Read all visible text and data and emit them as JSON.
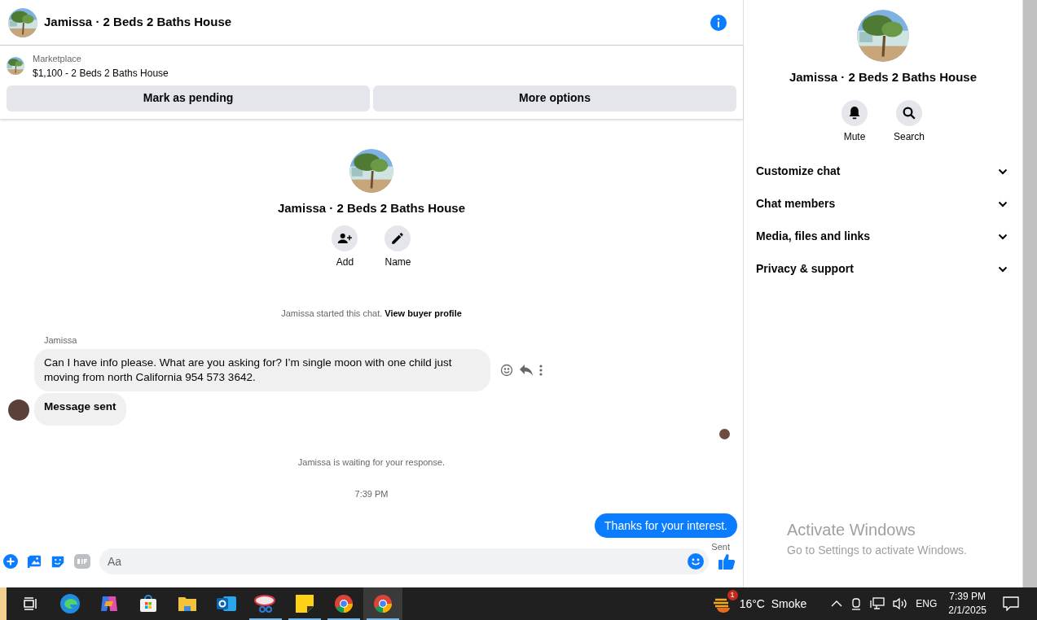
{
  "header": {
    "title": "Jamissa · 2 Beds 2 Baths House"
  },
  "listing": {
    "source": "Marketplace",
    "title": "$1,100 - 2 Beds 2 Baths House",
    "buttons": [
      "Mark as pending",
      "More options"
    ]
  },
  "chat_intro": {
    "title": "Jamissa · 2 Beds 2 Baths House",
    "actions": [
      {
        "kind": "add",
        "label": "Add"
      },
      {
        "kind": "name",
        "label": "Name"
      }
    ]
  },
  "notice": {
    "text": "Jamissa started this chat.",
    "link": "View buyer profile"
  },
  "messages": [
    {
      "kind": "incoming",
      "sender": "Jamissa",
      "text": "Can I have info please. What are you asking for? I’m single moon with one child just moving from north California 954 573 3642.",
      "bold": false
    },
    {
      "kind": "incoming",
      "text": "Message sent",
      "bold": true
    },
    {
      "kind": "status",
      "text": "Jamissa is waiting for your response."
    },
    {
      "kind": "time",
      "text": "7:39 PM"
    },
    {
      "kind": "outgoing",
      "text": "Thanks for your interest.",
      "status": "Sent"
    }
  ],
  "composer": {
    "placeholder": "Aa"
  },
  "details": {
    "title": "Jamissa · 2 Beds 2 Baths House",
    "actions": [
      {
        "kind": "mute",
        "label": "Mute"
      },
      {
        "kind": "search",
        "label": "Search"
      }
    ],
    "sections": [
      {
        "label": "Customize chat",
        "expanded": false
      },
      {
        "label": "Chat members",
        "expanded": false
      },
      {
        "label": "Media, files and links",
        "expanded": false
      },
      {
        "label": "Privacy & support",
        "expanded": false
      }
    ]
  },
  "activation": {
    "title": "Activate Windows",
    "subtitle": "Go to Settings to activate Windows."
  },
  "taskbar": {
    "apps": [
      {
        "kind": "taskview",
        "running": false,
        "selected": false
      },
      {
        "kind": "edge",
        "running": false,
        "selected": false
      },
      {
        "kind": "copilot",
        "running": false,
        "selected": false
      },
      {
        "kind": "store",
        "running": false,
        "selected": false
      },
      {
        "kind": "files",
        "running": false,
        "selected": false
      },
      {
        "kind": "outlook",
        "running": false,
        "selected": false
      },
      {
        "kind": "snip",
        "running": true,
        "selected": false
      },
      {
        "kind": "notes",
        "running": true,
        "selected": false
      },
      {
        "kind": "chrome",
        "running": true,
        "selected": false
      },
      {
        "kind": "chrome",
        "running": true,
        "selected": true
      }
    ],
    "weather_badge": "1",
    "weather": "16°C  Smoke",
    "language": "ENG",
    "time": "7:39 PM",
    "date": "2/1/2025"
  }
}
